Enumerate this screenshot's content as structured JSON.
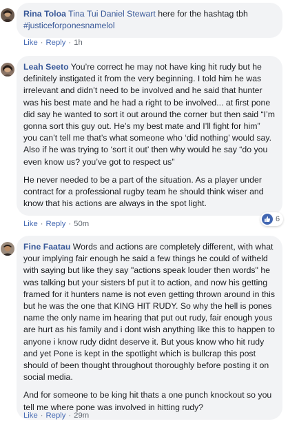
{
  "comments": [
    {
      "author": "Rina Toloa",
      "mentions": "Tina Tui Daniel Stewart",
      "text": " here for the hashtag tbh",
      "hashtag": "#justiceforponesnamelol",
      "actions": {
        "like": "Like",
        "reply": "Reply",
        "time": "1h"
      }
    },
    {
      "author": "Leah Seeto",
      "paragraph1": " You’re correct he may not have king hit rudy but he definitely instigated it from the very beginning. I told him he was irrelevant and didn’t need to be involved and he said that hunter was his best mate and he had a right to be involved... at first pone did say he wanted to sort it out around the corner but then said “I’m gonna sort this guy out. He’s my best mate and I’ll fight for him” you can’t tell me that’s what someone who ‘did nothing’ would say.",
      "paragraph1b": "Also if he was trying to ‘sort it out’ then why would he say “do you even know us? you’ve got to respect us”",
      "paragraph2": "He never needed to be a part of the situation. As a player under contract for a professional rugby team he should think wiser and know that his actions are always in the spot light.",
      "actions": {
        "like": "Like",
        "reply": "Reply",
        "time": "50m"
      },
      "reaction": {
        "icon": "thumbs-up-icon",
        "count": "6"
      }
    },
    {
      "author": "Fine Faatau",
      "paragraph1": " Words and actions are completely different, with what your implying fair enough he said a few things he could of witheld with saying but like they say \"actions speak louder then words\" he was talking but your sisters bf put it to action, and now his getting framed for it hunters name is not even getting thrown around in this but he was the one that KING HIT RUDY. So why the hell is pones name the only name im hearing that put out rudy, fair enough yous are hurt as his family and i dont wish anything like this to happen to anyone i know rudy didnt deserve it. But yous know who hit rudy and yet Pone is kept in the spotlight which is bullcrap this post should of been thought throughout thoroughly before posting it on social media.",
      "paragraph2": "And for someone to be king hit thats a one punch knockout so you tell me where pone was involved in hitting rudy?",
      "actions": {
        "like": "Like",
        "reply": "Reply",
        "time": "29m"
      }
    }
  ],
  "colors": {
    "bubble_bg": "#f2f3f5",
    "author": "#385898",
    "link": "#4267b2",
    "meta": "#606770"
  }
}
